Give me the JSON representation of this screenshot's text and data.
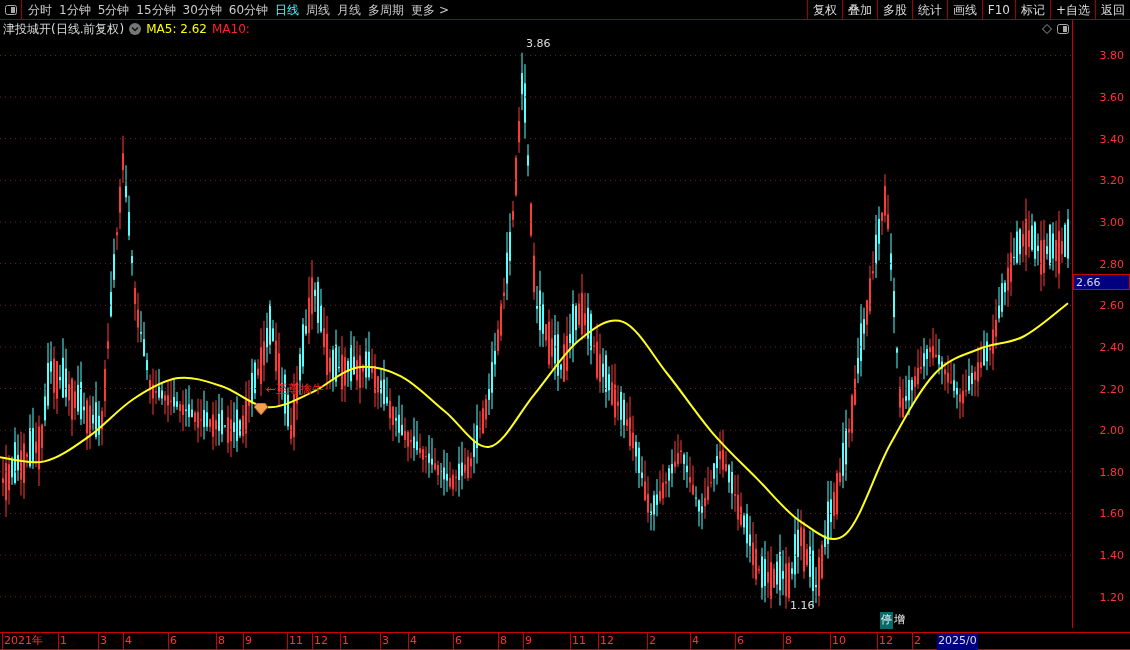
{
  "toolbar": {
    "periods": [
      {
        "label": "分时",
        "selected": false
      },
      {
        "label": "1分钟",
        "selected": false
      },
      {
        "label": "5分钟",
        "selected": false
      },
      {
        "label": "15分钟",
        "selected": false
      },
      {
        "label": "30分钟",
        "selected": false
      },
      {
        "label": "60分钟",
        "selected": false
      },
      {
        "label": "日线",
        "selected": true
      },
      {
        "label": "周线",
        "selected": false
      },
      {
        "label": "月线",
        "selected": false
      },
      {
        "label": "多周期",
        "selected": false
      },
      {
        "label": "更多 >",
        "selected": false
      }
    ],
    "actions": [
      "复权",
      "叠加",
      "多股",
      "统计",
      "画线",
      "F10",
      "标记",
      "+自选",
      "返回"
    ]
  },
  "legend": {
    "title": "津投城开(日线.前复权)",
    "ma5": "MA5: 2.62",
    "ma10": "MA10:"
  },
  "chart": {
    "high_label": "3.86",
    "low_label": "1.16",
    "signal_label": "←至尊擒牛",
    "event_tags": [
      "停",
      "增"
    ],
    "current_price": "2.66",
    "chart_data": {
      "type": "line",
      "ylim": [
        1.05,
        3.97
      ],
      "grid": true,
      "yticks": [
        {
          "value": 3.8,
          "label": "3.80"
        },
        {
          "value": 3.6,
          "label": "3.60"
        },
        {
          "value": 3.4,
          "label": "3.40"
        },
        {
          "value": 3.2,
          "label": "3.20"
        },
        {
          "value": 3.0,
          "label": "3.00"
        },
        {
          "value": 2.8,
          "label": "2.80"
        },
        {
          "value": 2.6,
          "label": "2.60"
        },
        {
          "value": 2.4,
          "label": "2.40"
        },
        {
          "value": 2.2,
          "label": "2.20"
        },
        {
          "value": 2.0,
          "label": "2.00"
        },
        {
          "value": 1.8,
          "label": "1.80"
        },
        {
          "value": 1.6,
          "label": "1.60"
        },
        {
          "value": 1.4,
          "label": "1.40"
        },
        {
          "value": 1.2,
          "label": "1.20"
        }
      ],
      "series": [
        {
          "color": "#ffff20",
          "values": [
            1.87,
            1.85,
            1.97,
            2.15,
            2.25,
            2.21,
            2.11,
            2.18,
            2.3,
            2.26,
            2.09,
            1.92,
            2.17,
            2.43,
            2.52,
            2.27,
            1.99,
            1.77,
            1.56,
            1.5,
            1.93,
            2.27,
            2.39,
            2.45,
            2.61
          ]
        }
      ]
    }
  },
  "time_axis": [
    "2021年",
    "1",
    "3",
    "4",
    "6",
    "8",
    "9",
    "11",
    "12",
    "1",
    "3",
    "4",
    "6",
    "8",
    "9",
    "11",
    "12",
    "2",
    "4",
    "6",
    "8",
    "10",
    "12",
    "2",
    "2025/0"
  ]
}
